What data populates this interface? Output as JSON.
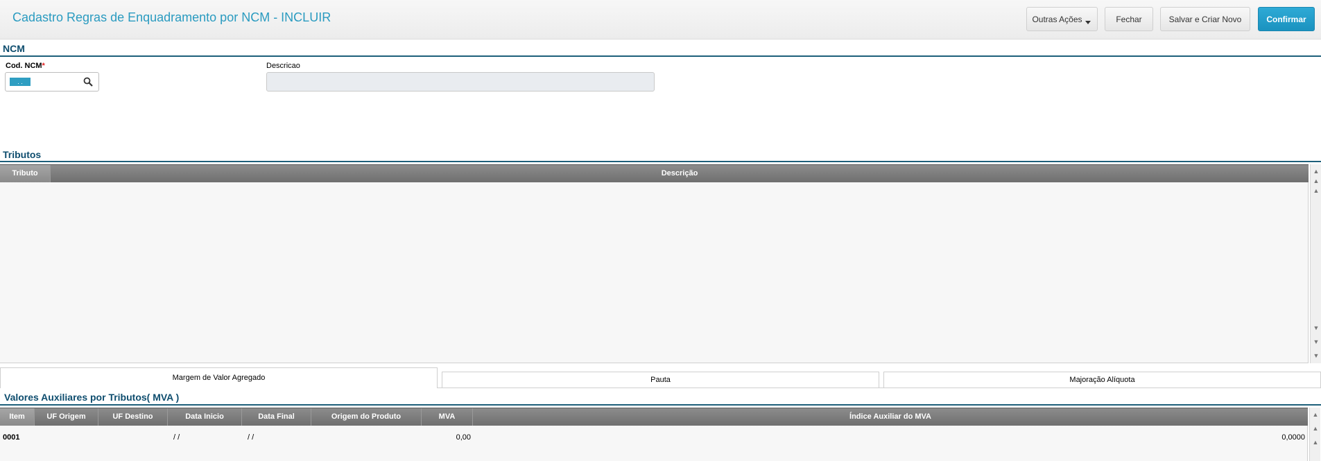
{
  "header": {
    "title": "Cadastro Regras de Enquadramento por NCM - INCLUIR",
    "buttons": {
      "more_actions": "Outras Ações",
      "close": "Fechar",
      "save_new": "Salvar e Criar Novo",
      "confirm": "Confirmar"
    }
  },
  "ncm_section": {
    "title": "NCM",
    "cod_label": "Cod. NCM",
    "required_mark": "*",
    "cod_value": ". .",
    "desc_label": "Descricao"
  },
  "tributos_section": {
    "title": "Tributos",
    "columns": [
      "Tributo",
      "Descrição"
    ]
  },
  "tabs": [
    "Margem de Valor Agregado",
    "Pauta",
    "Majoração Alíquota"
  ],
  "mva_section": {
    "title": "Valores Auxiliares por Tributos( MVA )",
    "columns": [
      "Item",
      "UF Origem",
      "UF Destino",
      "Data Inicio",
      "Data Final",
      "Origem do Produto",
      "MVA",
      "Índice Auxiliar do MVA"
    ],
    "rows": [
      {
        "item": "0001",
        "uf_origem": "",
        "uf_destino": "",
        "data_inicio": "/ /",
        "data_final": "/ /",
        "origem_produto": "",
        "mva": "0,00",
        "indice": "0,0000"
      }
    ]
  },
  "colors": {
    "accent": "#2a9bc0",
    "section": "#0e4d6e",
    "primary_button": "#1a92bf",
    "grid_header": "#7d7d7d"
  },
  "icons": [
    "search-icon",
    "caret-down-icon",
    "scroll-up-icon",
    "scroll-down-icon"
  ]
}
